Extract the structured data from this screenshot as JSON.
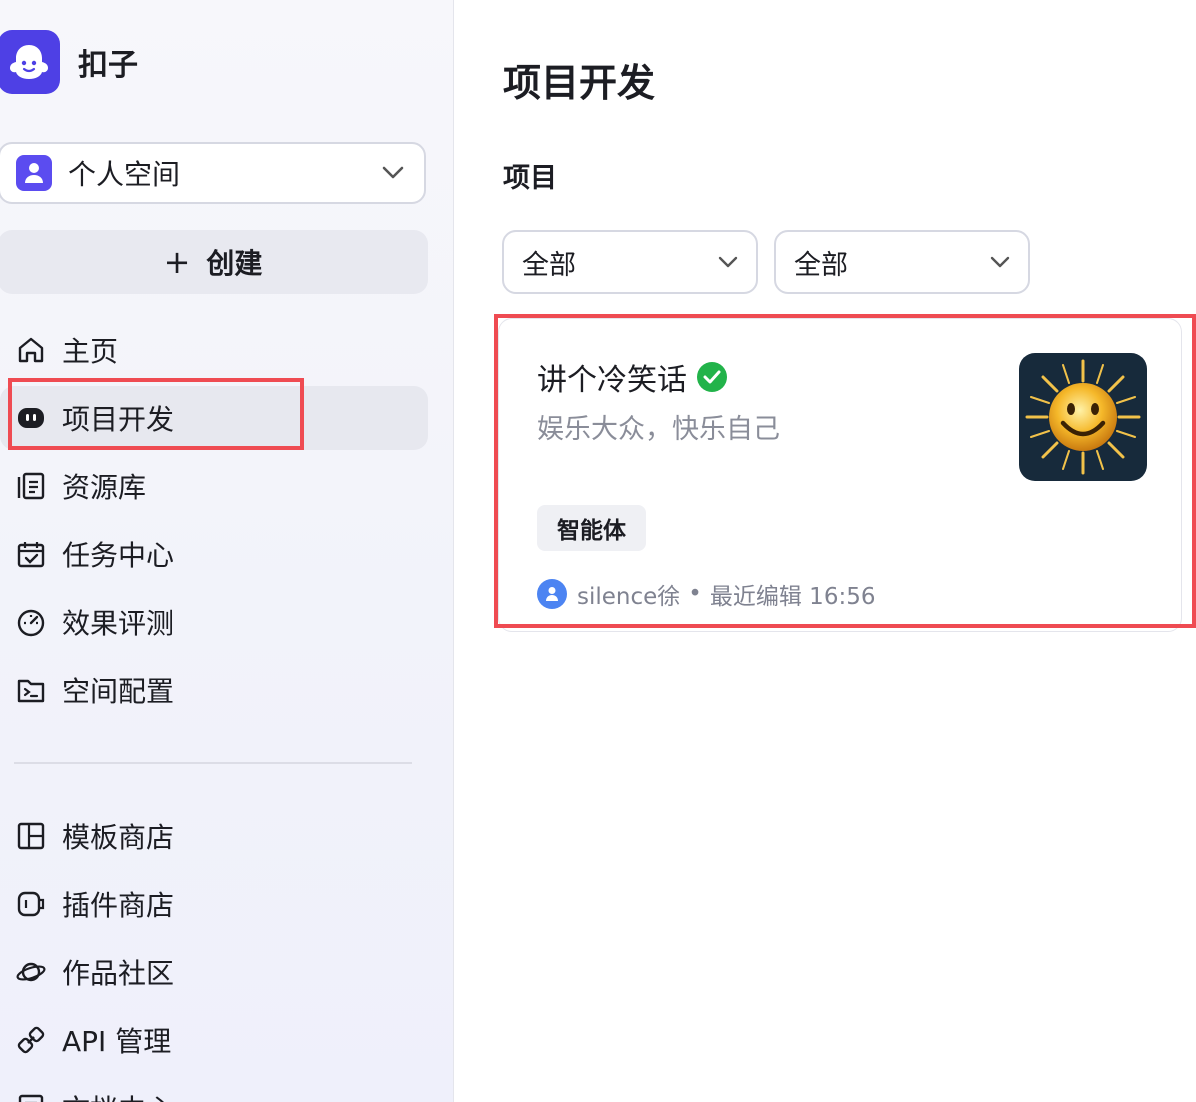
{
  "app": {
    "name": "扣子",
    "logo_icon": "ghost-logo-icon",
    "accent_color": "#4e40e5"
  },
  "sidebar": {
    "workspace": {
      "label": "个人空间",
      "icon": "user-avatar-icon"
    },
    "create_button": {
      "plus": "+",
      "label": "创建"
    },
    "primary_nav": [
      {
        "label": "主页",
        "icon": "home-icon"
      },
      {
        "label": "项目开发",
        "icon": "project-dev-icon",
        "active": true
      },
      {
        "label": "资源库",
        "icon": "library-icon"
      },
      {
        "label": "任务中心",
        "icon": "task-calendar-icon"
      },
      {
        "label": "效果评测",
        "icon": "speedometer-icon"
      },
      {
        "label": "空间配置",
        "icon": "folder-terminal-icon"
      }
    ],
    "secondary_nav": [
      {
        "label": "模板商店",
        "icon": "template-grid-icon"
      },
      {
        "label": "插件商店",
        "icon": "plugin-icon"
      },
      {
        "label": "作品社区",
        "icon": "planet-icon"
      },
      {
        "label": "API 管理",
        "icon": "link-icon"
      },
      {
        "label": "文档中心",
        "icon": "document-icon"
      }
    ]
  },
  "main": {
    "title": "项目开发",
    "section_title": "项目",
    "filters": [
      {
        "value": "全部"
      },
      {
        "value": "全部"
      }
    ],
    "projects": [
      {
        "name": "讲个冷笑话",
        "verified": true,
        "description": "娱乐大众，快乐自己",
        "thumbnail_icon": "smiling-sun-icon",
        "tag": "智能体",
        "author": "silence徐",
        "separator": "•",
        "edited": "最近编辑 16:56"
      }
    ]
  },
  "highlight_color": "#ef4b52"
}
